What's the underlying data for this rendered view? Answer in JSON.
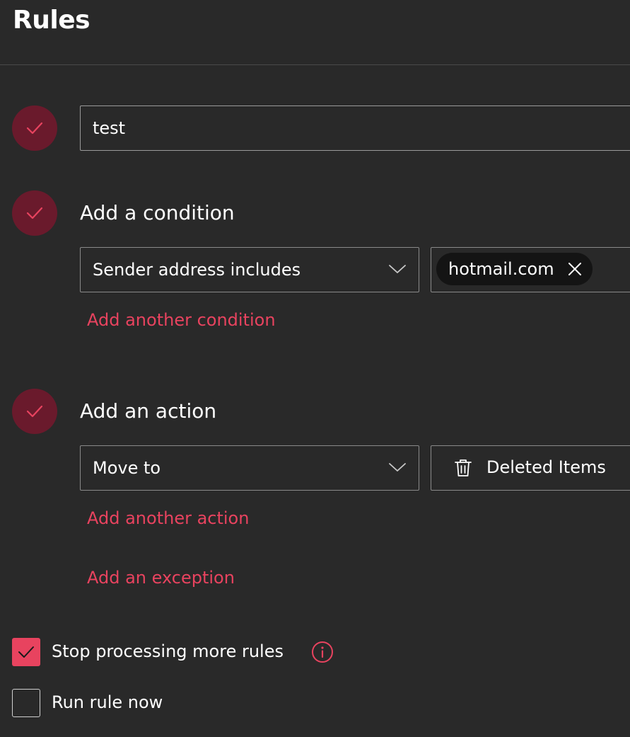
{
  "page": {
    "title": "Rules"
  },
  "rule_name": {
    "value": "test"
  },
  "condition": {
    "heading": "Add a condition",
    "type": "Sender address includes",
    "chips": [
      "hotmail.com"
    ],
    "add_another": "Add another condition"
  },
  "action": {
    "heading": "Add an action",
    "type": "Move to",
    "folder": "Deleted Items",
    "add_another": "Add another action"
  },
  "exception": {
    "add_label": "Add an exception"
  },
  "options": {
    "stop_processing": {
      "label": "Stop processing more rules",
      "checked": true
    },
    "run_now": {
      "label": "Run rule now",
      "checked": false
    }
  },
  "icons": {
    "step_complete": "checkmark-icon",
    "dropdown": "chevron-down-icon",
    "remove_chip": "close-icon",
    "folder": "trash-icon",
    "info": "info-icon"
  },
  "colors": {
    "background": "#292929",
    "accent": "#e8435f",
    "step_circle": "#6a1a2c"
  }
}
